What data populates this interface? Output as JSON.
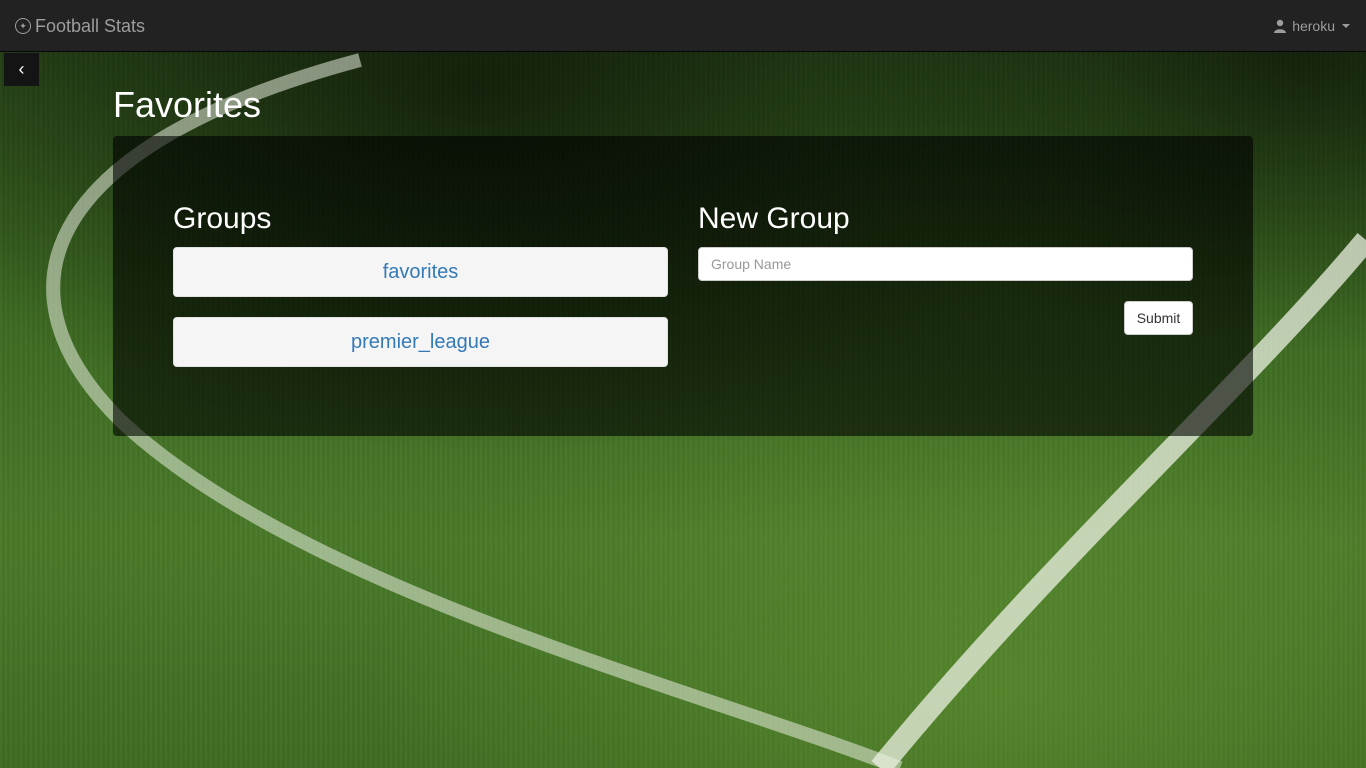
{
  "navbar": {
    "brand": "Football Stats",
    "brand_icon": "soccer-ball-icon",
    "user": "heroku",
    "user_icon": "user-icon"
  },
  "back_icon": "chevron-left-icon",
  "back_glyph": "‹",
  "page": {
    "title": "Favorites"
  },
  "groups": {
    "title": "Groups",
    "items": [
      {
        "label": "favorites"
      },
      {
        "label": "premier_league"
      }
    ]
  },
  "new_group": {
    "title": "New Group",
    "input_placeholder": "Group Name",
    "input_value": "",
    "submit_label": "Submit"
  },
  "colors": {
    "navbar": "#222222",
    "link": "#337ab7",
    "panel": "rgba(0,0,0,0.6)"
  }
}
